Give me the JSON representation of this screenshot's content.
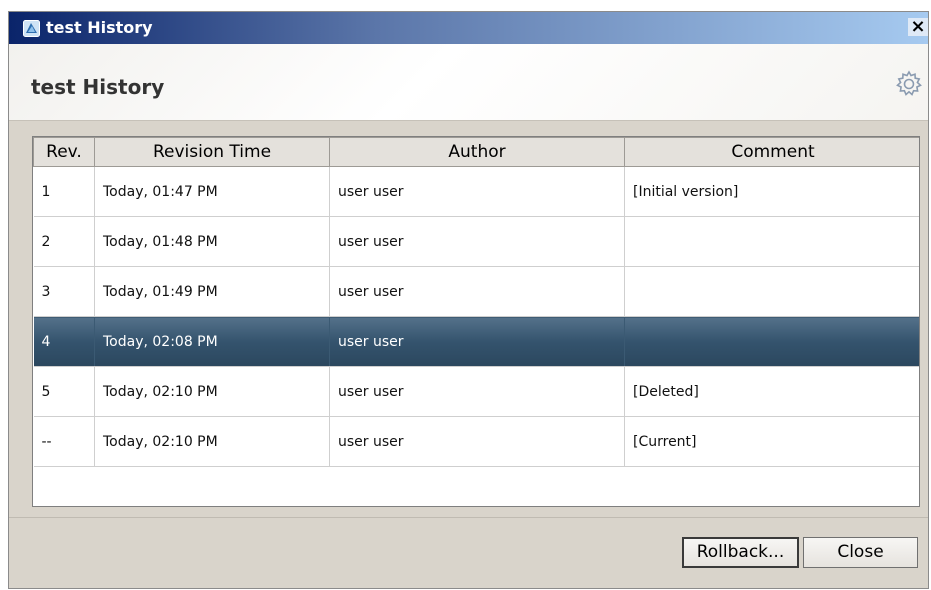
{
  "window": {
    "title": "test History",
    "close_glyph": "×"
  },
  "header": {
    "title": "test History",
    "icon": "gear-icon"
  },
  "table": {
    "columns": [
      "Rev.",
      "Revision Time",
      "Author",
      "Comment"
    ],
    "rows": [
      {
        "rev": "1",
        "time": "Today, 01:47 PM",
        "author": "user user",
        "comment": "[Initial version]"
      },
      {
        "rev": "2",
        "time": "Today, 01:48 PM",
        "author": "user user",
        "comment": ""
      },
      {
        "rev": "3",
        "time": "Today, 01:49 PM",
        "author": "user user",
        "comment": ""
      },
      {
        "rev": "4",
        "time": "Today, 02:08 PM",
        "author": "user user",
        "comment": ""
      },
      {
        "rev": "5",
        "time": "Today, 02:10 PM",
        "author": "user user",
        "comment": "[Deleted]"
      },
      {
        "rev": "--",
        "time": "Today, 02:10 PM",
        "author": "user user",
        "comment": "[Current]"
      }
    ],
    "selected_row": 4
  },
  "buttons": {
    "rollback": "Rollback...",
    "close": "Close"
  },
  "colors": {
    "selection": "#34536d",
    "titlebar_start": "#0a246a",
    "titlebar_end": "#a6caf0"
  }
}
